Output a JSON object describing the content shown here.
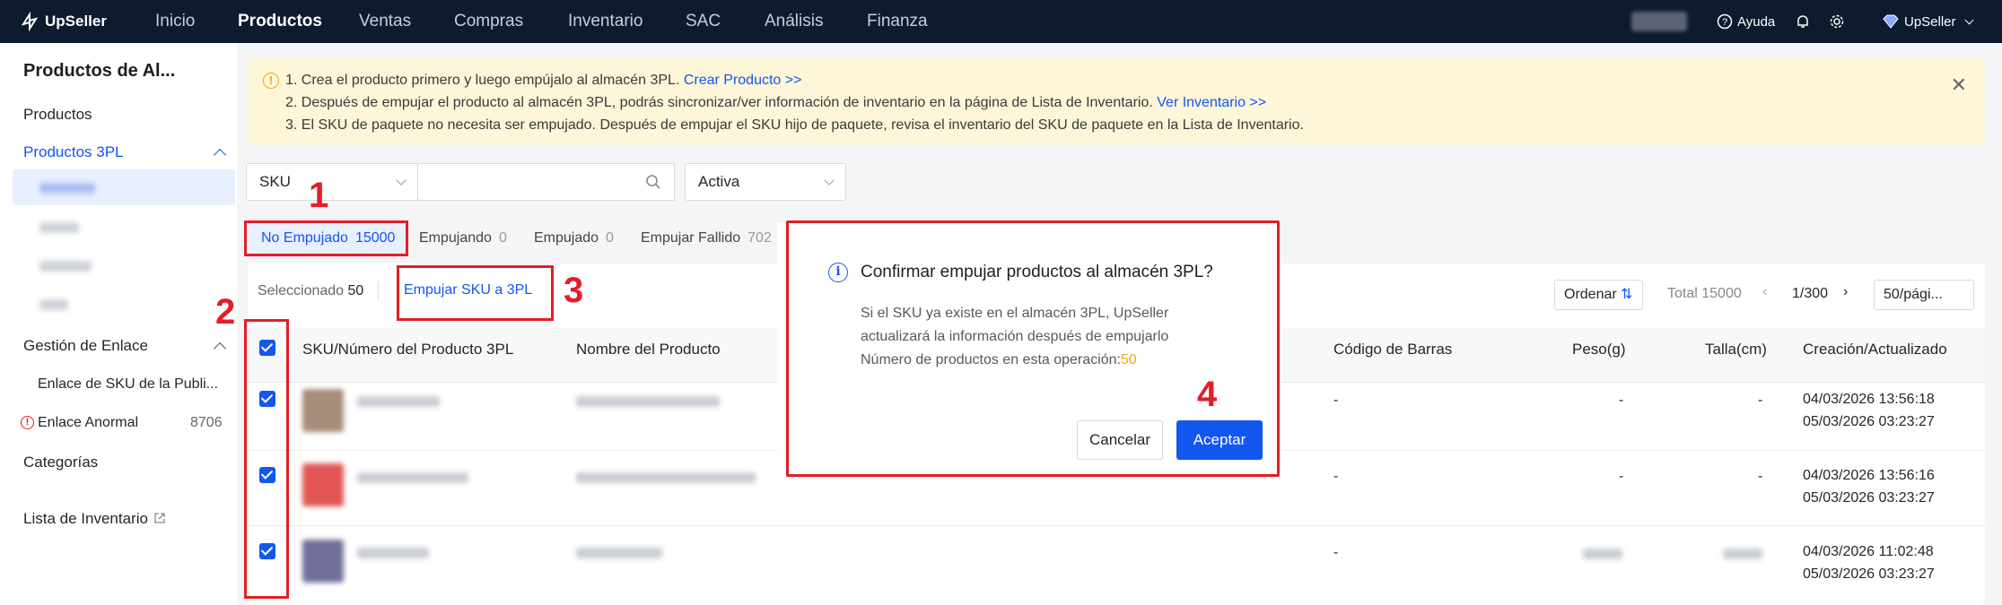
{
  "nav": {
    "logo": "UpSeller",
    "items": [
      "Inicio",
      "Productos",
      "Ventas",
      "Compras",
      "Inventario",
      "SAC",
      "Análisis",
      "Finanza"
    ],
    "active": "Productos",
    "help": "Ayuda",
    "user": "UpSeller"
  },
  "sidebar": {
    "title": "Productos de Al...",
    "productos": "Productos",
    "productos_3pl": "Productos 3PL",
    "gestion": "Gestión de Enlace",
    "enlace_sku": "Enlace de SKU de la Publi...",
    "enlace_anormal": "Enlace Anormal",
    "enlace_anormal_count": "8706",
    "categorias": "Categorías",
    "lista_inventario": "Lista de Inventario"
  },
  "banner": {
    "line1": "1. Crea el producto primero y luego empújalo al almacén 3PL.",
    "link1": "Crear Producto >>",
    "line2": "2. Después de empujar el producto al almacén 3PL, podrás sincronizar/ver información de inventario en la página de Lista de Inventario.",
    "link2": "Ver Inventario >>",
    "line3": "3. El SKU de paquete no necesita ser empujado. Después de empujar el SKU hijo de paquete, revisa el inventario del SKU de paquete en la Lista de Inventario."
  },
  "filters": {
    "field": "SKU",
    "status": "Activa"
  },
  "tabs": [
    {
      "label": "No Empujado",
      "count": "15000"
    },
    {
      "label": "Empujando",
      "count": "0"
    },
    {
      "label": "Empujado",
      "count": "0"
    },
    {
      "label": "Empujar Fallido",
      "count": "702"
    }
  ],
  "toolbar": {
    "selected_label": "Seleccionado",
    "selected_count": "50",
    "push_button": "Empujar SKU a 3PL",
    "sort": "Ordenar",
    "total": "Total 15000",
    "page": "1/300",
    "page_size": "50/pági..."
  },
  "table": {
    "headers": [
      "SKU/Número del Producto 3PL",
      "Nombre del Producto",
      "Código de Barras",
      "Peso(g)",
      "Talla(cm)",
      "Creación/Actualizado"
    ],
    "rows": [
      {
        "barcode": "-",
        "weight": "-",
        "size": "-",
        "created": "04/03/2026 13:56:18",
        "updated": "05/03/2026 03:23:27"
      },
      {
        "barcode": "-",
        "weight": "-",
        "size": "-",
        "created": "04/03/2026 13:56:16",
        "updated": "05/03/2026 03:23:27"
      },
      {
        "barcode": "-",
        "weight": "",
        "size": "",
        "created": "04/03/2026 11:02:48",
        "updated": "05/03/2026 03:23:27"
      }
    ]
  },
  "dialog": {
    "title": "Confirmar empujar productos al almacén 3PL?",
    "body1": "Si el SKU ya existe en el almacén 3PL, UpSeller",
    "body2": "actualizará la información después de empujarlo",
    "body3": "Número de productos en esta operación:",
    "count": "50",
    "cancel": "Cancelar",
    "ok": "Aceptar"
  },
  "annotations": [
    "1",
    "2",
    "3",
    "4"
  ]
}
